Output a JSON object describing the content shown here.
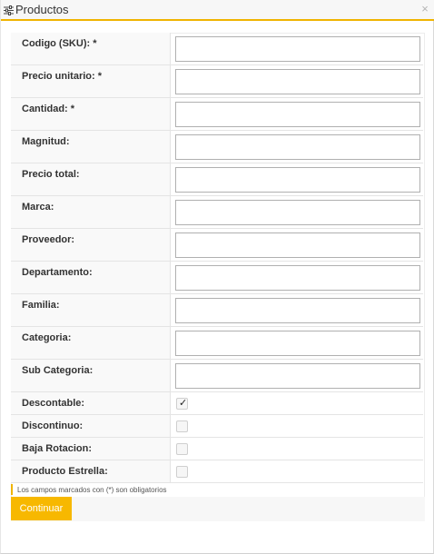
{
  "window": {
    "title": "Productos",
    "title_icon": "sliders-icon",
    "close_glyph": "×",
    "accent_color": "#f0b400"
  },
  "form": {
    "fields": [
      {
        "label": "Codigo (SKU): *",
        "value": ""
      },
      {
        "label": "Precio unitario: *",
        "value": ""
      },
      {
        "label": "Cantidad: *",
        "value": ""
      },
      {
        "label": "Magnitud:",
        "value": ""
      },
      {
        "label": "Precio total:",
        "value": ""
      },
      {
        "label": "Marca:",
        "value": ""
      },
      {
        "label": "Proveedor:",
        "value": ""
      },
      {
        "label": "Departamento:",
        "value": ""
      },
      {
        "label": "Familia:",
        "value": ""
      },
      {
        "label": "Categoria:",
        "value": ""
      },
      {
        "label": "Sub Categoria:",
        "value": ""
      }
    ],
    "checkboxes": [
      {
        "label": "Descontable:",
        "checked": true
      },
      {
        "label": "Discontinuo:",
        "checked": false
      },
      {
        "label": "Baja Rotacion:",
        "checked": false
      },
      {
        "label": "Producto Estrella:",
        "checked": false
      }
    ],
    "required_note": "Los campos marcados con (*) son obligatorios",
    "submit_label": "Continuar",
    "check_glyph": "✓"
  }
}
